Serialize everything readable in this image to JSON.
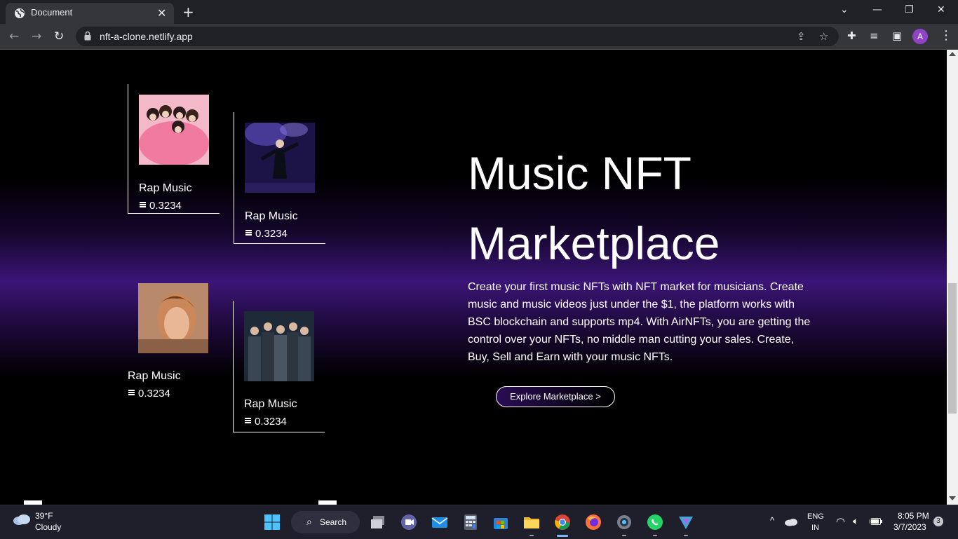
{
  "browser": {
    "tab_title": "Document",
    "tab_close": "✕",
    "new_tab": "+",
    "url": "nft-a-clone.netlify.app",
    "avatar_initial": "A",
    "icons": [
      "back-icon",
      "forward-icon",
      "reload-icon",
      "lock-icon",
      "share-icon",
      "star-icon",
      "extensions-icon",
      "media-icon",
      "sidepanel-icon",
      "menu-icon"
    ]
  },
  "cards": [
    {
      "title": "Rap Music",
      "price": "0.3234"
    },
    {
      "title": "Rap Music",
      "price": "0.3234"
    },
    {
      "title": "Rap Music",
      "price": "0.3234"
    },
    {
      "title": "Rap Music",
      "price": "0.3234"
    }
  ],
  "hero": {
    "title_line1": "Music NFT",
    "title_line2": "Marketplace",
    "description": "Create your first music NFTs with NFT market for musicians. Create music and music videos just under the $1, the platform works with BSC blockchain and supports mp4. With AirNFTs, you are getting the control over your NFTs, no middle man cutting your sales. Create, Buy, Sell and Earn with your music NFTs.",
    "cta": "Explore Marketplace >"
  },
  "taskbar": {
    "weather_temp": "39°F",
    "weather_cond": "Cloudy",
    "search_label": "Search",
    "lang_top": "ENG",
    "lang_bottom": "IN",
    "time": "8:05 PM",
    "date": "3/7/2023",
    "notifications": "3"
  },
  "colors": {
    "accent_purple": "#3b1577",
    "background": "#000000"
  }
}
